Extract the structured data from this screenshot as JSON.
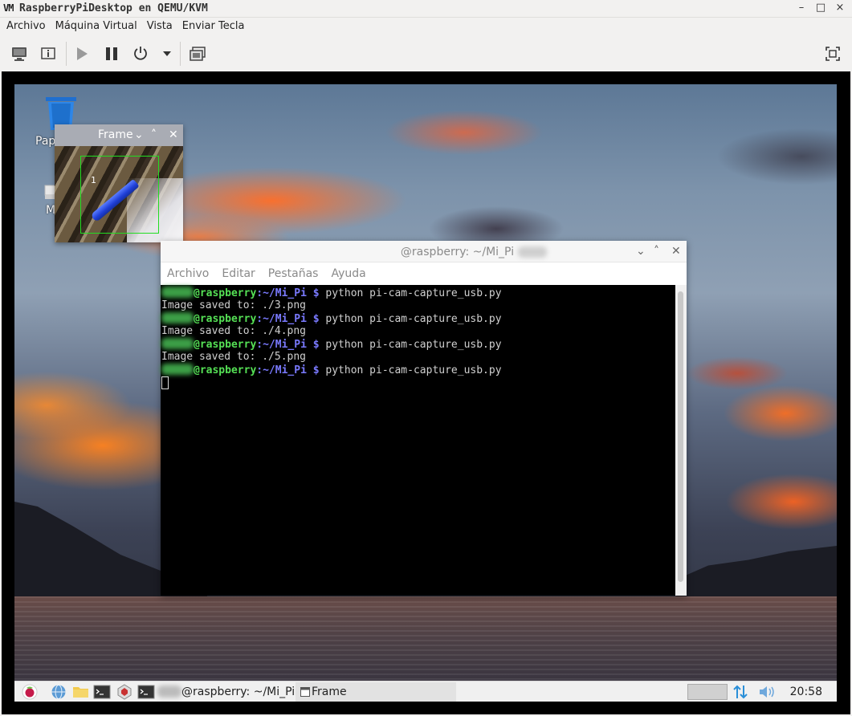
{
  "qemu": {
    "logo": "VM",
    "title": "RaspberryPiDesktop en QEMU/KVM",
    "window_buttons": {
      "minimize": "–",
      "maximize": "□",
      "close": "×"
    },
    "menu": [
      "Archivo",
      "Máquina Virtual",
      "Vista",
      "Enviar Tecla"
    ],
    "toolbar_icons": [
      "monitor-icon",
      "info-icon",
      "play-icon",
      "pause-icon",
      "power-icon",
      "dropdown-arrow-icon",
      "screenshot-icon",
      "fullscreen-icon"
    ]
  },
  "desktop": {
    "icons": [
      {
        "label": "Pap",
        "icon": "trash-icon"
      },
      {
        "label": "M",
        "icon": "drive-icon"
      }
    ]
  },
  "frame_window": {
    "title": "Frame",
    "detection_label": "1",
    "controls": {
      "dropdown": "⌄",
      "up": "˄",
      "close": "✕"
    }
  },
  "terminal": {
    "title": "@raspberry: ~/Mi_Pi",
    "menu": [
      "Archivo",
      "Editar",
      "Pestañas",
      "Ayuda"
    ],
    "controls": {
      "minimize": "⌄",
      "maximize": "˄",
      "close": "✕"
    },
    "lines": [
      {
        "type": "prompt",
        "host": "@raspberry",
        "path": ":~/Mi_Pi",
        "dollar": " $ ",
        "cmd": "python pi-cam-capture_usb.py"
      },
      {
        "type": "output",
        "text": "Image saved to: ./3.png"
      },
      {
        "type": "prompt",
        "host": "@raspberry",
        "path": ":~/Mi_Pi",
        "dollar": " $ ",
        "cmd": "python pi-cam-capture_usb.py"
      },
      {
        "type": "output",
        "text": "Image saved to: ./4.png"
      },
      {
        "type": "prompt",
        "host": "@raspberry",
        "path": ":~/Mi_Pi",
        "dollar": " $ ",
        "cmd": "python pi-cam-capture_usb.py"
      },
      {
        "type": "output",
        "text": "Image saved to: ./5.png"
      },
      {
        "type": "prompt",
        "host": "@raspberry",
        "path": ":~/Mi_Pi",
        "dollar": " $ ",
        "cmd": "python pi-cam-capture_usb.py"
      },
      {
        "type": "cursor"
      }
    ]
  },
  "taskbar": {
    "terminal_task": "@raspberry: ~/Mi_Pi",
    "frame_task": "Frame",
    "clock": "20:58"
  }
}
